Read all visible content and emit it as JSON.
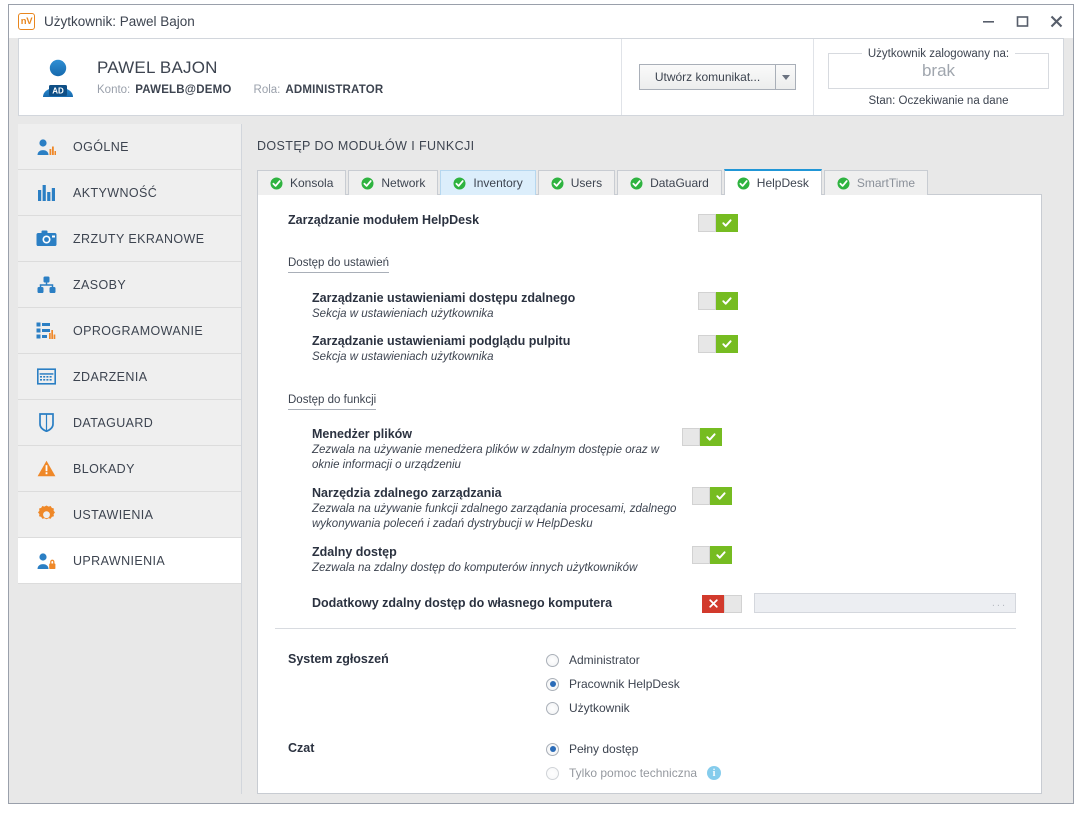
{
  "window": {
    "app_badge": "nV",
    "title": "Użytkownik: Pawel Bajon",
    "controls": {
      "minimize": "minimize-icon",
      "maximize": "maximize-icon",
      "close": "close-icon"
    }
  },
  "header": {
    "avatar_badge": "AD",
    "user_name": "PAWEL BAJON",
    "account_key": "Konto:",
    "account_value": "PAWELB@DEMO",
    "role_key": "Rola:",
    "role_value": "ADMINISTRATOR",
    "message_button": "Utwórz komunikat...",
    "logged_legend": "Użytkownik zalogowany na:",
    "logged_value": "brak",
    "state_line": "Stan: Oczekiwanie na dane"
  },
  "sidebar": {
    "items": [
      {
        "label": "OGÓLNE",
        "icon": "user-chart-icon",
        "active": false
      },
      {
        "label": "AKTYWNOŚĆ",
        "icon": "bar-chart-icon",
        "active": false
      },
      {
        "label": "ZRZUTY EKRANOWE",
        "icon": "camera-icon",
        "active": false
      },
      {
        "label": "ZASOBY",
        "icon": "sitemap-icon",
        "active": false
      },
      {
        "label": "OPROGRAMOWANIE",
        "icon": "software-list-icon",
        "active": false
      },
      {
        "label": "ZDARZENIA",
        "icon": "calendar-icon",
        "active": false
      },
      {
        "label": "DATAGUARD",
        "icon": "shield-icon",
        "active": false
      },
      {
        "label": "BLOKADY",
        "icon": "warning-triangle-icon",
        "active": false
      },
      {
        "label": "USTAWIENIA",
        "icon": "gear-icon",
        "active": false
      },
      {
        "label": "UPRAWNIENIA",
        "icon": "user-lock-icon",
        "active": true
      }
    ]
  },
  "content": {
    "title": "DOSTĘP DO MODUŁÓW I FUNKCJI",
    "tabs": [
      {
        "label": "Konsola",
        "state": "normal"
      },
      {
        "label": "Network",
        "state": "normal"
      },
      {
        "label": "Inventory",
        "state": "hover"
      },
      {
        "label": "Users",
        "state": "normal"
      },
      {
        "label": "DataGuard",
        "state": "normal"
      },
      {
        "label": "HelpDesk",
        "state": "active"
      },
      {
        "label": "SmartTime",
        "state": "dim"
      }
    ],
    "master_option": {
      "title": "Zarządzanie modułem HelpDesk",
      "toggle": "on"
    },
    "settings_section_head": "Dostęp do ustawień",
    "settings_options": [
      {
        "title": "Zarządzanie ustawieniami dostępu zdalnego",
        "desc": "Sekcja w ustawieniach użytkownika",
        "toggle": "on"
      },
      {
        "title": "Zarządzanie ustawieniami podglądu pulpitu",
        "desc": "Sekcja w ustawieniach użytkownika",
        "toggle": "on"
      }
    ],
    "functions_section_head": "Dostęp do funkcji",
    "function_options": [
      {
        "title": "Menedżer plików",
        "desc": "Zezwala na używanie menedżera plików w zdalnym dostępie oraz w oknie informacji o urządzeniu",
        "toggle": "on"
      },
      {
        "title": "Narzędzia zdalnego zarządzania",
        "desc": "Zezwala na używanie funkcji zdalnego zarządania procesami, zdalnego wykonywania poleceń i zadań dystrybucji w HelpDesku",
        "toggle": "on"
      },
      {
        "title": "Zdalny dostęp",
        "desc": "Zezwala na zdalny dostęp do komputerów innych użytkowników",
        "toggle": "on"
      }
    ],
    "extra_access": {
      "title": "Dodatkowy zdalny dostęp do własnego komputera",
      "toggle": "off",
      "field_value": "",
      "field_ellipsis": "..."
    },
    "radio_groups": [
      {
        "label": "System zgłoszeń",
        "options": [
          {
            "label": "Administrator",
            "checked": false
          },
          {
            "label": "Pracownik HelpDesk",
            "checked": true
          },
          {
            "label": "Użytkownik",
            "checked": false
          }
        ]
      },
      {
        "label": "Czat",
        "options": [
          {
            "label": "Pełny dostęp",
            "checked": true
          },
          {
            "label": "Tylko pomoc techniczna",
            "checked": false,
            "info": "i"
          }
        ]
      }
    ]
  },
  "colors": {
    "accent_blue": "#2196d6",
    "toggle_on": "#76bc21",
    "toggle_off": "#d23a2c",
    "brand_orange": "#e8861e",
    "icon_blue": "#2b7fc4",
    "info_blue": "#23a3dd"
  }
}
